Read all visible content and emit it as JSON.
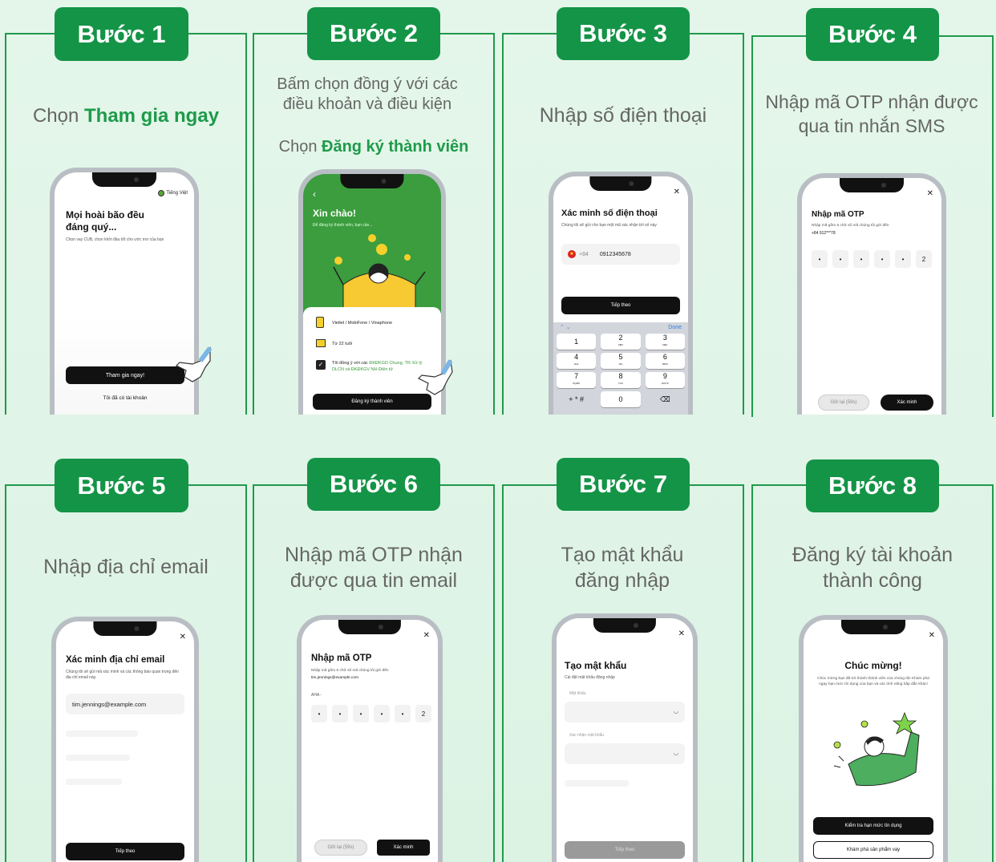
{
  "steps": [
    {
      "badge": "Bước 1",
      "desc_plain": "Chọn ",
      "desc_bold": "Tham gia ngay",
      "screen": {
        "lang": "Tiếng Việt",
        "heading": "Mọi hoài bão đều đáng quý...",
        "sub": "Chọn vay CUB, chọn khởi đầu tốt cho ước mơ của bạn",
        "primary": "Tham gia ngay!",
        "secondary": "Tôi đã có tài khoản"
      }
    },
    {
      "badge": "Bước 2",
      "desc_line1": "Bấm chọn đồng ý với các điều khoản và điều kiện",
      "desc_plain": "Chọn ",
      "desc_bold": "Đăng ký thành viên",
      "screen": {
        "heading": "Xin chào!",
        "sub": "Để đăng ký thành viên, bạn cần...",
        "item1": "Viettel / MobiFone / Vinaphone",
        "item2": "Từ 22 tuổi",
        "item3_plain": "Tôi đồng ý với các ",
        "item3_link": "ĐKĐKGD Chung, TR Xử lý DLCN và ĐKĐKGV NH Điện tử",
        "button": "Đăng ký thành viên"
      }
    },
    {
      "badge": "Bước 3",
      "desc": "Nhập số điện thoại",
      "screen": {
        "heading": "Xác minh số điện thoại",
        "sub": "Chúng tôi sẽ gửi cho bạn một mã xác nhận tới số này",
        "code": "+84",
        "phone": "0912345678",
        "button": "Tiếp theo",
        "done": "Done",
        "keys": [
          [
            "1",
            ""
          ],
          [
            "2",
            "ABC"
          ],
          [
            "3",
            "DEF"
          ],
          [
            "4",
            "GHI"
          ],
          [
            "5",
            "JKL"
          ],
          [
            "6",
            "MNO"
          ],
          [
            "7",
            "PQRS"
          ],
          [
            "8",
            "TUV"
          ],
          [
            "9",
            "WXYZ"
          ],
          [
            "+ * #",
            ""
          ],
          [
            "0",
            ""
          ],
          [
            "⌫",
            ""
          ]
        ]
      }
    },
    {
      "badge": "Bước 4",
      "desc": "Nhập mã OTP nhận được qua tin nhắn SMS",
      "screen": {
        "heading": "Nhập mã OTP",
        "sub": "Nhập mã gồm 6 chữ số mã chúng tôi gửi đến",
        "phone": "+84 912***78",
        "digits": [
          "•",
          "•",
          "•",
          "•",
          "•",
          "2"
        ],
        "resend": "Gửi lại (59s)",
        "confirm": "Xác minh"
      }
    },
    {
      "badge": "Bước 5",
      "desc": "Nhập địa chỉ email",
      "screen": {
        "heading": "Xác minh địa chỉ email",
        "sub": "Chúng tôi sẽ gửi mã xác minh và các thông báo quan trọng đến địa chỉ email này.",
        "email": "tim.jennings@example.com",
        "button": "Tiếp theo"
      }
    },
    {
      "badge": "Bước 6",
      "desc": "Nhập mã OTP nhận được qua tin email",
      "screen": {
        "heading": "Nhập mã OTP",
        "sub": "Nhập mã gồm 6 chữ số mã chúng tôi gửi đến",
        "email": "tim.jennings@example.com",
        "prefix": "AHA -",
        "digits": [
          "•",
          "•",
          "•",
          "•",
          "•",
          "2"
        ],
        "resend": "Gửi lại (59s)",
        "confirm": "Xác minh"
      }
    },
    {
      "badge": "Bước 7",
      "desc": "Tạo mật khẩu đăng nhập",
      "screen": {
        "heading": "Tạo mật khẩu",
        "sub": "Cài đặt mật khẩu đăng nhập",
        "label1": "Mật khẩu",
        "label2": "Xác nhận mật khẩu",
        "button": "Tiếp theo"
      }
    },
    {
      "badge": "Bước 8",
      "desc": "Đăng ký tài khoản thành công",
      "screen": {
        "heading": "Chúc mừng!",
        "sub": "Chúc mừng bạn đã trở thành thành viên của chúng tôi! Khám phá ngay hạn mức tín dụng của bạn và các tính năng hấp dẫn khác!",
        "primary": "Kiểm tra hạn mức tín dụng",
        "secondary": "Khám phá sản phẩm vay"
      }
    }
  ],
  "colors": {
    "green": "#149447",
    "accent_text": "#1e9a4a",
    "border": "#1f9a4b"
  }
}
